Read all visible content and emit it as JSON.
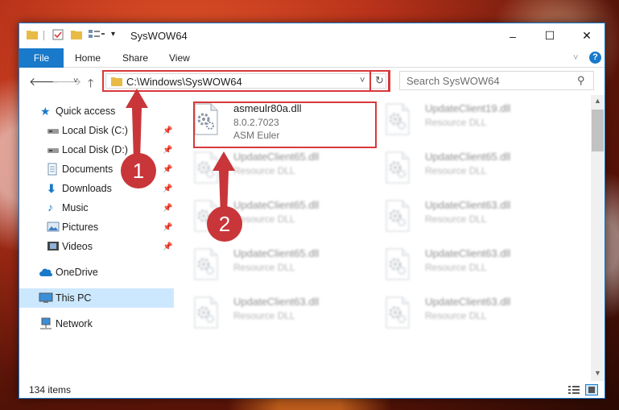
{
  "window": {
    "title": "SysWOW64",
    "controls": {
      "minimize": "–",
      "maximize": "☐",
      "close": "✕"
    }
  },
  "ribbon": {
    "file_tab": "File",
    "tabs": [
      "Home",
      "Share",
      "View"
    ]
  },
  "address": {
    "path": "C:\\Windows\\SysWOW64",
    "search_placeholder": "Search SysWOW64"
  },
  "nav": {
    "quick_access": "Quick access",
    "items": [
      {
        "label": "Local Disk (C:)",
        "icon": "drive-icon"
      },
      {
        "label": "Local Disk (D:)",
        "icon": "drive-icon"
      },
      {
        "label": "Documents",
        "icon": "documents-icon"
      },
      {
        "label": "Downloads",
        "icon": "downloads-icon"
      },
      {
        "label": "Music",
        "icon": "music-icon"
      },
      {
        "label": "Pictures",
        "icon": "pictures-icon"
      },
      {
        "label": "Videos",
        "icon": "videos-icon"
      }
    ],
    "onedrive": "OneDrive",
    "this_pc": "This PC",
    "network": "Network"
  },
  "files": [
    {
      "name": "asmeulr80a.dll",
      "type": "8.0.2.7023",
      "sub": "ASM Euler",
      "highlight": true
    },
    {
      "name": "UpdateClient19.dll",
      "type": "Resource DLL",
      "sub": ""
    },
    {
      "name": "UpdateClient65.dll",
      "type": "Resource DLL",
      "sub": ""
    },
    {
      "name": "UpdateClient65.dll",
      "type": "Resource DLL",
      "sub": ""
    },
    {
      "name": "UpdateClient65.dll",
      "type": "Resource DLL",
      "sub": ""
    },
    {
      "name": "UpdateClient63.dll",
      "type": "Resource DLL",
      "sub": ""
    },
    {
      "name": "UpdateClient65.dll",
      "type": "Resource DLL",
      "sub": ""
    },
    {
      "name": "UpdateClient63.dll",
      "type": "Resource DLL",
      "sub": ""
    },
    {
      "name": "UpdateClient63.dll",
      "type": "Resource DLL",
      "sub": ""
    },
    {
      "name": "UpdateClient63.dll",
      "type": "Resource DLL",
      "sub": ""
    }
  ],
  "status": {
    "item_count": "134 items"
  },
  "callouts": [
    "1",
    "2"
  ],
  "colors": {
    "accent": "#1979ca",
    "highlight": "#d9383a",
    "selected_nav": "#cce8ff"
  }
}
